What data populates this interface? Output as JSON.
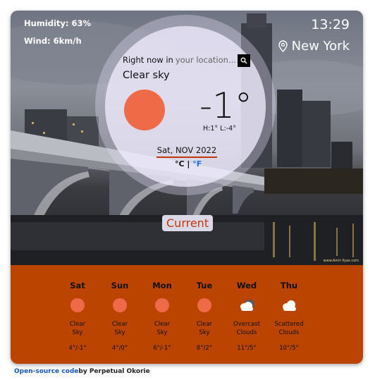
{
  "current": {
    "humidity": "Humidity: 63%",
    "wind": "Wind: 6km/h",
    "time": "13:29",
    "city": "New York",
    "prompt_prefix": "Right now in",
    "prompt_location": "your location...",
    "condition": "Clear sky",
    "temperature": "-1°",
    "hi_lo": "H:1° L:-4°",
    "date": "Sat, NOV 2022",
    "unit_c": "°C",
    "unit_sep": " | ",
    "unit_f": "°F",
    "label": "Current",
    "watermark": "www.Amir Ilyas.com"
  },
  "forecast": [
    {
      "day": "Sat",
      "desc_line1": "Clear",
      "desc_line2": "Sky",
      "range": "4°/-1°",
      "icon": "sun-icon"
    },
    {
      "day": "Sun",
      "desc_line1": "Clear",
      "desc_line2": "Sky",
      "range": "4°/0°",
      "icon": "sun-icon"
    },
    {
      "day": "Mon",
      "desc_line1": "Clear",
      "desc_line2": "Sky",
      "range": "6°/-1°",
      "icon": "sun-icon"
    },
    {
      "day": "Tue",
      "desc_line1": "Clear",
      "desc_line2": "Sky",
      "range": "8°/2°",
      "icon": "sun-icon"
    },
    {
      "day": "Wed",
      "desc_line1": "Overcast",
      "desc_line2": "Clouds",
      "range": "11°/5°",
      "icon": "overcast-clouds-icon"
    },
    {
      "day": "Thu",
      "desc_line1": "Scattered",
      "desc_line2": "Clouds",
      "range": "10°/5°",
      "icon": "cloud-icon"
    }
  ],
  "footer": {
    "link_text": "Open-source code",
    "byline": "by Perpetual Okorie"
  },
  "colors": {
    "accent": "#c0390b",
    "forecast_bg": "#bb4500",
    "sun": "#ef6a47",
    "fahrenheit": "#1e6fe0",
    "link": "#1558b0"
  }
}
